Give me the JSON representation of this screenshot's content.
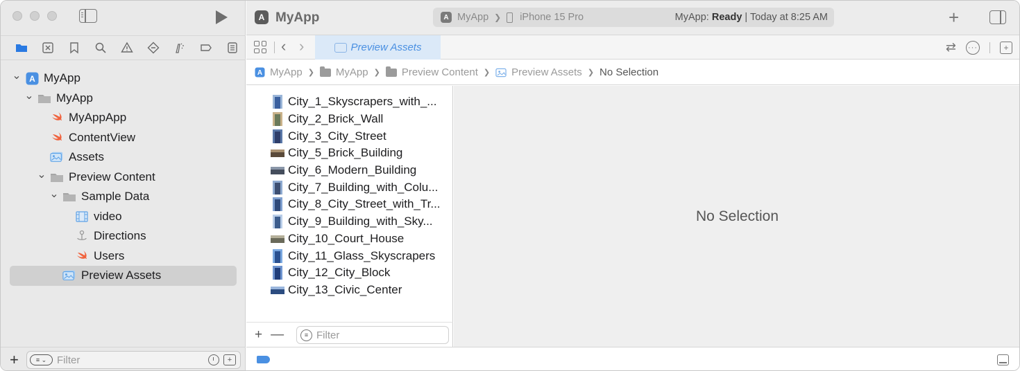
{
  "toolbar": {
    "app_name": "MyApp",
    "scheme": "MyApp",
    "device": "iPhone 15 Pro",
    "status_prefix": "MyApp: ",
    "status_state": "Ready",
    "status_suffix": " | Today at 8:25 AM"
  },
  "tab": {
    "label": "Preview Assets"
  },
  "breadcrumb": [
    "MyApp",
    "MyApp",
    "Preview Content",
    "Preview Assets",
    "No Selection"
  ],
  "navigator": {
    "tree": [
      {
        "label": "MyApp",
        "icon": "app-icon",
        "depth": 0,
        "chevron": "open"
      },
      {
        "label": "MyApp",
        "icon": "folder-icon",
        "depth": 1,
        "chevron": "open"
      },
      {
        "label": "MyAppApp",
        "icon": "swift-file-icon",
        "depth": 2,
        "chevron": ""
      },
      {
        "label": "ContentView",
        "icon": "swift-file-icon",
        "depth": 2,
        "chevron": ""
      },
      {
        "label": "Assets",
        "icon": "asset-catalog-icon",
        "depth": 2,
        "chevron": ""
      },
      {
        "label": "Preview Content",
        "icon": "folder-icon",
        "depth": 2,
        "chevron": "open"
      },
      {
        "label": "Sample Data",
        "icon": "folder-icon",
        "depth": 3,
        "chevron": "open"
      },
      {
        "label": "video",
        "icon": "video-file-icon",
        "depth": 4,
        "chevron": ""
      },
      {
        "label": "Directions",
        "icon": "map-pin-icon",
        "depth": 4,
        "chevron": ""
      },
      {
        "label": "Users",
        "icon": "swift-file-icon",
        "depth": 4,
        "chevron": ""
      },
      {
        "label": "Preview Assets",
        "icon": "asset-catalog-icon",
        "depth": 3,
        "chevron": "",
        "selected": true
      }
    ],
    "filter_placeholder": "Filter"
  },
  "assets": {
    "items": [
      "City_1_Skyscrapers_with_...",
      "City_2_Brick_Wall",
      "City_3_City_Street",
      "City_5_Brick_Building",
      "City_6_Modern_Building",
      "City_7_Building_with_Colu...",
      "City_8_City_Street_with_Tr...",
      "City_9_Building_with_Sky...",
      "City_10_Court_House",
      "City_11_Glass_Skyscrapers",
      "City_12_City_Block",
      "City_13_Civic_Center"
    ],
    "filter_placeholder": "Filter"
  },
  "detail": {
    "empty_label": "No Selection"
  },
  "colors": {
    "accent": "#4a90e2",
    "selection": "#d0d0d0",
    "swift": "#f0623d"
  }
}
